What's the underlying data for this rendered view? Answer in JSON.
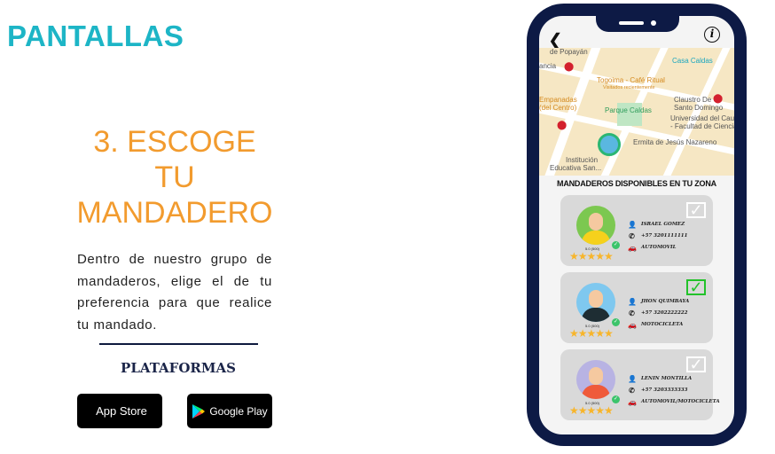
{
  "page": {
    "title": "PANTALLAS",
    "heading": [
      "3. ESCOGE",
      "TU",
      "MANDADERO"
    ],
    "description": "Dentro de nuestro grupo de mandaderos, elige el de tu preferencia para que realice tu mandado.",
    "platforms_label": "PLATAFORMAS",
    "app_store": "App Store",
    "google_play": "Google Play"
  },
  "phone": {
    "map_labels": [
      "de Popayán",
      "ancia",
      "Casa Caldas",
      "Togoima - Café Ritual",
      "Visitados recientemente",
      "Empanadas",
      "(del Centro)",
      "Parque Caldas",
      "Claustro De",
      "Santo Domingo",
      "Universidad del Cauca",
      "- Facultad de Ciencia",
      "Ermita de Jesús Nazareno",
      "Institución",
      "Educativa San..."
    ],
    "list_title": "MANDADEROS DISPONIBLES EN TU ZONA",
    "couriers": [
      {
        "name": "ISRAEL GOMEZ",
        "phone": "+57 3201111111",
        "vehicle": "AUTOMOVIL",
        "rating": "5.0 (500)",
        "stars": 5,
        "selected": false,
        "bg": "#7cc850",
        "shirt": "#f6d11c"
      },
      {
        "name": "JHON QUIMBAYA",
        "phone": "+57 3202222222",
        "vehicle": "MOTOCICLETA",
        "rating": "5.0 (500)",
        "stars": 5,
        "selected": true,
        "bg": "#7fc8ef",
        "shirt": "#1e2d33"
      },
      {
        "name": "LENIN MONTILLA",
        "phone": "+57 3203333333",
        "vehicle": "AUTOMOVIL/MOTOCICLETA",
        "rating": "5.0 (500)",
        "stars": 5,
        "selected": false,
        "bg": "#b8b3e3",
        "shirt": "#ef5a3a"
      }
    ]
  },
  "colors": {
    "title": "#1db5c6",
    "heading": "#f29b2e",
    "phone": "#0d1a45",
    "selected": "#22c22a"
  }
}
